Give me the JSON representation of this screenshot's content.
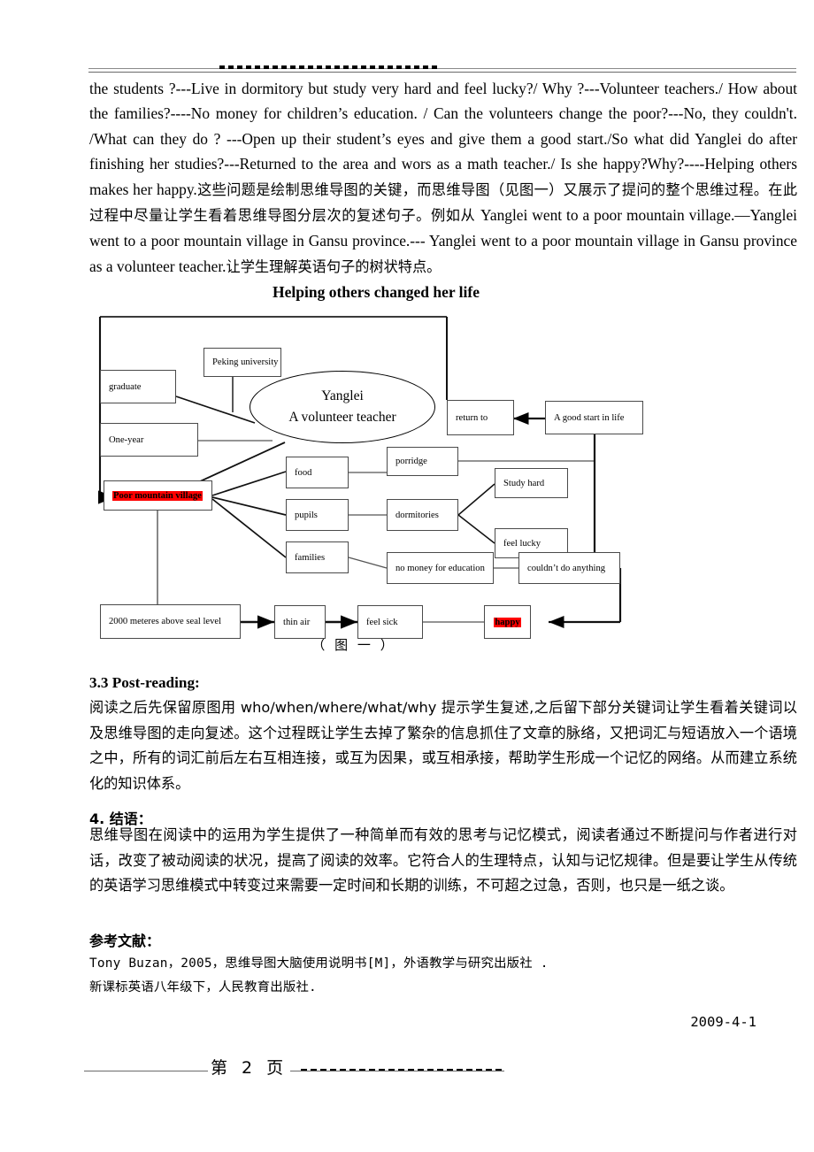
{
  "page": {
    "header_rule": "",
    "footer_page_label": "第 2 页",
    "date": "2009-4-1"
  },
  "paragraphs": {
    "top": "the students ?---Live in dormitory but study very hard and feel lucky?/ Why ?---Volunteer teachers./ How about the families?----No money for children’s education. / Can the volunteers change the poor?---No, they couldn't. /What can they do ? ---Open up their student’s eyes and give them a good start./So what did Yanglei do after finishing her studies?---Returned to the area and wors as a math teacher./ Is she happy?Why?----Helping others makes her happy.",
    "top_cn": "这些问题是绘制思维导图的关键，而思维导图（见图一）又展示了提问的整个思维过程。在此过程中尽量让学生看着思维导图分层次的复述句子。例如从 ",
    "top_en2": "Yanglei went to a poor mountain village.—Yanglei went to a poor mountain village in Gansu province.--- Yanglei went to a poor mountain village in Gansu province as a volunteer teacher.",
    "top_cn2": "让学生理解英语句子的树状特点。",
    "post_reading": "阅读之后先保留原图用 who/when/where/what/why 提示学生复述,之后留下部分关键词让学生看着关键词以及思维导图的走向复述。这个过程既让学生去掉了繁杂的信息抓住了文章的脉络，又把词汇与短语放入一个语境之中，所有的词汇前后左右互相连接，或互为因果，或互相承接，帮助学生形成一个记忆的网络。从而建立系统化的知识体系。",
    "conclusion": "思维导图在阅读中的运用为学生提供了一种简单而有效的思考与记忆模式，阅读者通过不断提问与作者进行对话，改变了被动阅读的状况，提高了阅读的效率。它符合人的生理特点，认知与记忆规律。但是要让学生从传统的英语学习思维模式中转变过来需要一定时间和长期的训练，不可超之过急，否则，也只是一纸之谈。"
  },
  "sections": {
    "post_reading_heading": "3.3  Post-reading:",
    "conclusion_heading": "4. 结语：",
    "references_heading": "参考文献："
  },
  "references": [
    "Tony Buzan，2005，思维导图大脑使用说明书[M]，外语教学与研究出版社 .",
    "新课标英语八年级下，人民教育出版社."
  ],
  "diagram": {
    "title": "Helping others changed her life",
    "caption": "（ 图 一 ）",
    "highlight_color": "#ff0000",
    "center": {
      "line1": "Yanglei",
      "line2": "A volunteer teacher"
    },
    "nodes": [
      {
        "id": "peking",
        "label": "Peking university"
      },
      {
        "id": "graduate",
        "label": "graduate"
      },
      {
        "id": "one-year",
        "label": "One-year"
      },
      {
        "id": "poor-village",
        "label": "Poor mountain village",
        "highlighted": true
      },
      {
        "id": "return-to",
        "label": "return to"
      },
      {
        "id": "good-start",
        "label": "A good start in life"
      },
      {
        "id": "food",
        "label": "food"
      },
      {
        "id": "porridge",
        "label": "porridge"
      },
      {
        "id": "pupils",
        "label": "pupils"
      },
      {
        "id": "dormitories",
        "label": "dormitories"
      },
      {
        "id": "study-hard",
        "label": "Study hard"
      },
      {
        "id": "feel-lucky",
        "label": "feel lucky"
      },
      {
        "id": "families",
        "label": "families"
      },
      {
        "id": "no-money",
        "label": "no money for education"
      },
      {
        "id": "couldnt",
        "label": "couldn’t do anything"
      },
      {
        "id": "altitude",
        "label": "2000 meteres above seal level"
      },
      {
        "id": "thin-air",
        "label": "thin air"
      },
      {
        "id": "feel-sick",
        "label": "feel sick"
      },
      {
        "id": "happy",
        "label": "happy",
        "highlighted": true
      }
    ]
  }
}
